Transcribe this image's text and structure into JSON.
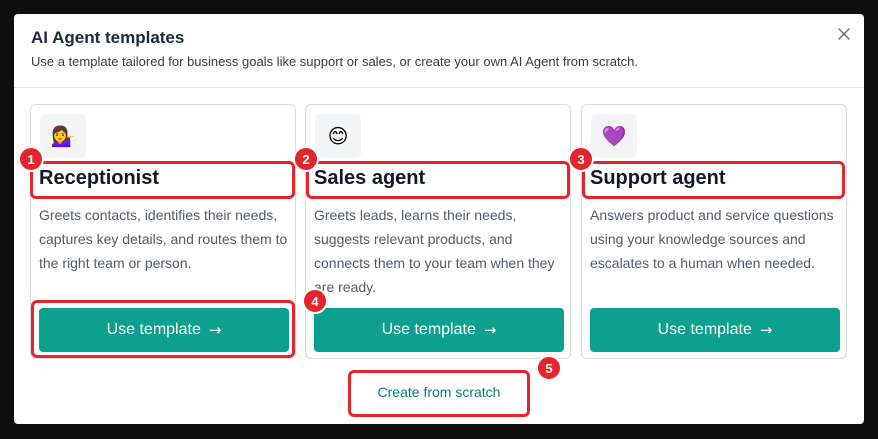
{
  "dialog": {
    "title": "AI Agent templates",
    "subtitle": "Use a template tailored for business goals like support or sales, or create your own AI Agent from scratch.",
    "close_icon": "close-icon"
  },
  "templates": [
    {
      "icon": "receptionist-emoji",
      "emoji": "💁‍♀️",
      "title": "Receptionist",
      "description": "Greets contacts, identifies their needs, captures key details, and routes them to the right team or person.",
      "button_label": "Use template"
    },
    {
      "icon": "smiling-face-emoji",
      "emoji": "😊",
      "title": "Sales agent",
      "description": "Greets leads, learns their needs, suggests relevant products, and connects them to your team when they are ready.",
      "button_label": "Use template"
    },
    {
      "icon": "purple-heart-emoji",
      "emoji": "💜",
      "title": "Support agent",
      "description": "Answers product and service questions using your knowledge sources and escalates to a human when needed.",
      "button_label": "Use template"
    }
  ],
  "arrow_glyph": "→",
  "scratch_link": "Create from scratch",
  "annotations": [
    "1",
    "2",
    "3",
    "4",
    "5"
  ],
  "colors": {
    "accent": "#0ca08f",
    "link": "#0b7d72",
    "highlight": "#e5242b"
  }
}
